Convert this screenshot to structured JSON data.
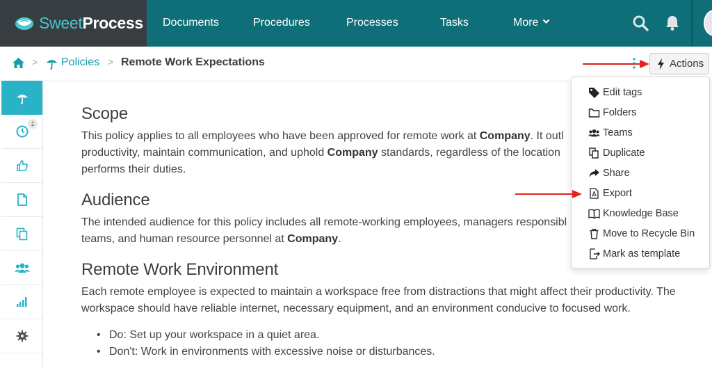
{
  "brand": {
    "part1": "Sweet",
    "part2": "Process"
  },
  "nav": {
    "items": [
      {
        "label": "Documents"
      },
      {
        "label": "Procedures"
      },
      {
        "label": "Processes"
      },
      {
        "label": "Tasks"
      },
      {
        "label": "More"
      }
    ]
  },
  "breadcrumb": {
    "section": "Policies",
    "current": "Remote Work Expectations",
    "separator": ">"
  },
  "actions": {
    "label": "Actions"
  },
  "sidebar": {
    "items": [
      {
        "icon": "umbrella-icon",
        "active": true
      },
      {
        "icon": "clock-icon",
        "badge": "1"
      },
      {
        "icon": "thumbs-up-icon"
      },
      {
        "icon": "document-icon"
      },
      {
        "icon": "copy-icon"
      },
      {
        "icon": "users-icon"
      },
      {
        "icon": "signal-bars-icon"
      },
      {
        "icon": "gear-icon"
      }
    ]
  },
  "menu": {
    "items": [
      {
        "label": "Edit tags",
        "icon": "tag-icon"
      },
      {
        "label": "Folders",
        "icon": "folder-icon"
      },
      {
        "label": "Teams",
        "icon": "users-icon"
      },
      {
        "label": "Duplicate",
        "icon": "duplicate-icon"
      },
      {
        "label": "Share",
        "icon": "share-icon"
      },
      {
        "label": "Export",
        "icon": "pdf-file-icon"
      },
      {
        "label": "Knowledge Base",
        "icon": "book-icon"
      },
      {
        "label": "Move to Recycle Bin",
        "icon": "trash-icon"
      },
      {
        "label": "Mark as template",
        "icon": "template-icon"
      }
    ]
  },
  "doc": {
    "scope": {
      "heading": "Scope",
      "line1_a": "This policy applies to all employees who have been approved for remote work at ",
      "line1_b": "Company",
      "line1_c": ". It outl",
      "line2_a": "productivity, maintain communication, and uphold ",
      "line2_b": "Company",
      "line2_c": " standards, regardless of the location",
      "line3": "performs their duties."
    },
    "audience": {
      "heading": "Audience",
      "line1": "The intended audience for this policy includes all remote-working employees, managers responsibl",
      "line2_a": "teams, and human resource personnel at ",
      "line2_b": "Company",
      "line2_c": "."
    },
    "environment": {
      "heading": "Remote Work Environment",
      "line1": "Each remote employee is expected to maintain a workspace free from distractions that might affect their productivity. The",
      "line2": "workspace should have reliable internet, necessary equipment, and an environment conducive to focused work.",
      "bullets": [
        "Do: Set up your workspace in a quiet area.",
        "Don't: Work in environments with excessive noise or disturbances."
      ]
    }
  },
  "colors": {
    "nav_bg": "#0e6f78",
    "logo_bg": "#373d41",
    "accent": "#2ab3c6",
    "link": "#1a9aaa",
    "arrow": "#e2231a"
  }
}
